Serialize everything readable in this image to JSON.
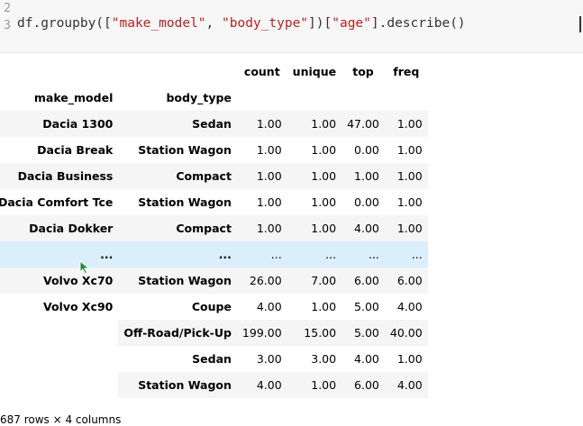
{
  "code": {
    "line_numbers": [
      "2",
      "3"
    ],
    "tokens": [
      {
        "t": "df.groupby([",
        "cls": ""
      },
      {
        "t": "\"make_model\"",
        "cls": "str"
      },
      {
        "t": ", ",
        "cls": ""
      },
      {
        "t": "\"body_type\"",
        "cls": "str"
      },
      {
        "t": "])[",
        "cls": ""
      },
      {
        "t": "\"age\"",
        "cls": "str"
      },
      {
        "t": "].describe()",
        "cls": ""
      }
    ]
  },
  "table": {
    "columns": [
      "count",
      "unique",
      "top",
      "freq"
    ],
    "index_names": [
      "make_model",
      "body_type"
    ],
    "rows": [
      {
        "make_model": "Dacia 1300",
        "body_type": "Sedan",
        "values": [
          "1.00",
          "1.00",
          "47.00",
          "1.00"
        ],
        "style": "odd"
      },
      {
        "make_model": "Dacia Break",
        "body_type": "Station Wagon",
        "values": [
          "1.00",
          "1.00",
          "0.00",
          "1.00"
        ],
        "style": ""
      },
      {
        "make_model": "Dacia Business",
        "body_type": "Compact",
        "values": [
          "1.00",
          "1.00",
          "1.00",
          "1.00"
        ],
        "style": "odd"
      },
      {
        "make_model": "Dacia Comfort Tce",
        "body_type": "Station Wagon",
        "values": [
          "1.00",
          "1.00",
          "0.00",
          "1.00"
        ],
        "style": ""
      },
      {
        "make_model": "Dacia Dokker",
        "body_type": "Compact",
        "values": [
          "1.00",
          "1.00",
          "4.00",
          "1.00"
        ],
        "style": "odd"
      },
      {
        "make_model": "...",
        "body_type": "...",
        "values": [
          "...",
          "...",
          "...",
          "..."
        ],
        "style": "hover"
      },
      {
        "make_model": "Volvo Xc70",
        "body_type": "Station Wagon",
        "values": [
          "26.00",
          "7.00",
          "6.00",
          "6.00"
        ],
        "style": "odd"
      },
      {
        "make_model": "Volvo Xc90",
        "body_type": "Coupe",
        "values": [
          "4.00",
          "1.00",
          "5.00",
          "4.00"
        ],
        "style": ""
      },
      {
        "make_model": "",
        "body_type": "Off-Road/Pick-Up",
        "values": [
          "199.00",
          "15.00",
          "5.00",
          "40.00"
        ],
        "style": "odd"
      },
      {
        "make_model": "",
        "body_type": "Sedan",
        "values": [
          "3.00",
          "3.00",
          "4.00",
          "1.00"
        ],
        "style": ""
      },
      {
        "make_model": "",
        "body_type": "Station Wagon",
        "values": [
          "4.00",
          "1.00",
          "6.00",
          "4.00"
        ],
        "style": "odd"
      }
    ]
  },
  "footer_text": "687 rows × 4 columns"
}
